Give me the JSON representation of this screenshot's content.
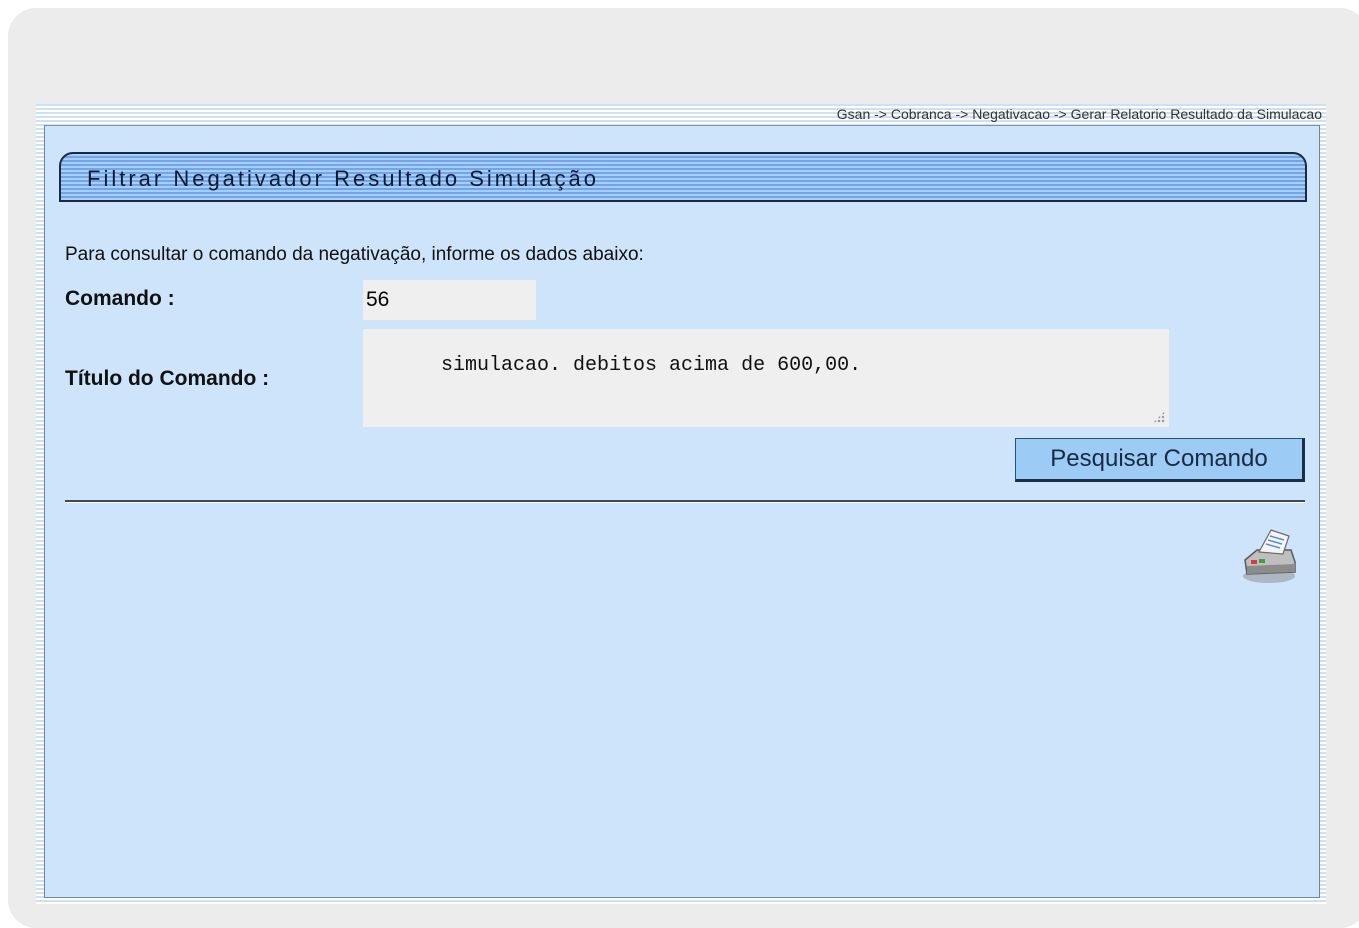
{
  "breadcrumb": "Gsan -> Cobranca -> Negativacao -> Gerar Relatorio Resultado da Simulacao",
  "panel": {
    "title": "Filtrar Negativador Resultado Simulação"
  },
  "form": {
    "instructions": "Para consultar o comando da negativação, informe os dados abaixo:",
    "comando_label": "Comando :",
    "comando_value": "56",
    "titulo_label": "Título do Comando :",
    "titulo_value": "simulacao. debitos acima de 600,00.",
    "search_button_label": "Pesquisar Comando"
  },
  "icons": {
    "print": "printer-icon"
  },
  "colors": {
    "panel_background": "#cde4fa",
    "title_bar": "#7fb3f0",
    "button_background": "#9ccbf6",
    "field_background": "#efefef"
  }
}
